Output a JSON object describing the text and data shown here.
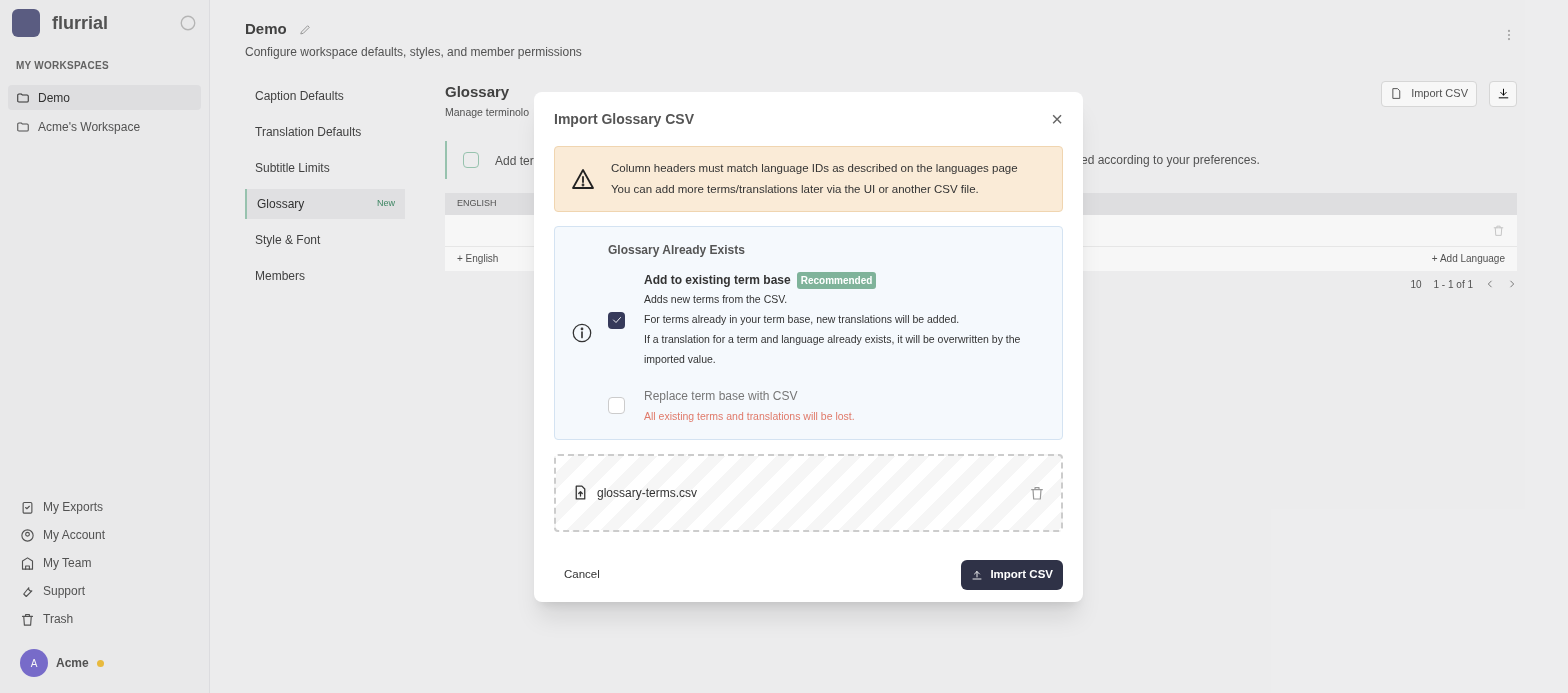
{
  "sidebar": {
    "logo_text": "flurrial",
    "workspaces_header": "MY WORKSPACES",
    "workspaces": [
      {
        "label": "Demo",
        "selected": true
      },
      {
        "label": "Acme's Workspace",
        "selected": false
      }
    ],
    "footer_items": [
      {
        "label": "My Exports",
        "kind": "exports"
      },
      {
        "label": "My Account",
        "kind": "account"
      },
      {
        "label": "My Team",
        "kind": "team"
      },
      {
        "label": "Support",
        "kind": "support"
      },
      {
        "label": "Trash",
        "kind": "trash"
      }
    ],
    "user": {
      "name": "Acme",
      "initial": "A"
    }
  },
  "header": {
    "title": "Demo",
    "subtitle": "Configure workspace defaults, styles, and member permissions"
  },
  "settings_nav": [
    {
      "label": "Caption Defaults",
      "selected": false
    },
    {
      "label": "Translation Defaults",
      "selected": false
    },
    {
      "label": "Subtitle Limits",
      "selected": false
    },
    {
      "label": "Glossary",
      "selected": true,
      "badge": "New"
    },
    {
      "label": "Style & Font",
      "selected": false
    },
    {
      "label": "Members",
      "selected": false
    }
  ],
  "glossary": {
    "title": "Glossary",
    "subtitle": "Manage terminolo",
    "banner_left": "Add ter",
    "banner_right": "ed according to your preferences.",
    "import_button": "Import CSV",
    "column": "ENGLISH",
    "add_row": "+ English",
    "add_language": "+ Add Language",
    "page_size": "10",
    "range": "1 - 1 of 1"
  },
  "modal": {
    "title": "Import Glossary CSV",
    "close": "×",
    "warning": {
      "line1": "Column headers must match language IDs as described on the",
      "link": "languages page",
      "line2": "You can add more terms/translations later via the UI or another CSV file."
    },
    "section_title": "Glossary Already Exists",
    "options": [
      {
        "kind": "merge",
        "label": "Add to existing term base",
        "badge": "Recommended",
        "checked": true,
        "lines": [
          "Adds new terms from the CSV.",
          "For terms already in your term base, new translations will be added.",
          "If a translation for a term and language already exists, it will be overwritten by the imported value."
        ]
      },
      {
        "kind": "replace",
        "label": "Replace term base with CSV",
        "checked": false,
        "note": "All existing terms and translations will be lost."
      }
    ],
    "file_name": "glossary-terms.csv",
    "cancel": "Cancel",
    "submit": "Import CSV"
  }
}
